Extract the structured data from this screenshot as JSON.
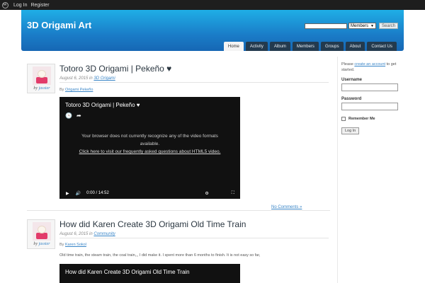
{
  "adminbar": {
    "login": "Log In",
    "register": "Register",
    "logo_letter": "W"
  },
  "header": {
    "site_title": "3D Origami Art",
    "search_placeholder": "",
    "search_scope": "Members",
    "search_button": "Search"
  },
  "nav": {
    "tabs": [
      {
        "label": "Home",
        "active": true
      },
      {
        "label": "Activity"
      },
      {
        "label": "Album"
      },
      {
        "label": "Members"
      },
      {
        "label": "Groups"
      },
      {
        "label": "About"
      },
      {
        "label": "Contact Us"
      }
    ]
  },
  "posts": [
    {
      "title": "Totoro 3D Origami | Pekeño ♥",
      "date": "August 6, 2015",
      "in_word": "in",
      "category": "3D Origami",
      "by_word": "By",
      "author": "Origami Pekeño",
      "avatar_by": "by",
      "avatar_user": "jasster",
      "video": {
        "title": "Totoro 3D Origami | Pekeño ♥",
        "msg_line1": "Your browser does not currently recognize any of the video formats available.",
        "msg_link": "Click here to visit our frequently asked questions about HTML5 video.",
        "time": "0:00 / 14:52"
      },
      "comments": "No Comments »"
    },
    {
      "title": "How did Karen Create 3D Origami Old Time Train",
      "date": "August 6, 2015",
      "in_word": "in",
      "category": "Community",
      "by_word": "By",
      "author": "Karen Sokol",
      "avatar_by": "by",
      "avatar_user": "jasster",
      "excerpt": "Old time train, the steam train, the coal train,,, I did make it. I spent more than 6 months to finish. It is not easy so far,",
      "video": {
        "title": "How did Karen Create 3D Origami Old Time Train"
      }
    }
  ],
  "sidebar": {
    "intro_pre": "Please",
    "intro_link": "create an account",
    "intro_post": "to get started.",
    "username_label": "Username",
    "password_label": "Password",
    "remember_label": "Remember Me",
    "login_button": "Log In"
  },
  "icons": {
    "clock": "🕓",
    "share": "➦",
    "play": "▶",
    "volume": "🔊",
    "gear": "⚙",
    "fullscreen": "⛶"
  }
}
